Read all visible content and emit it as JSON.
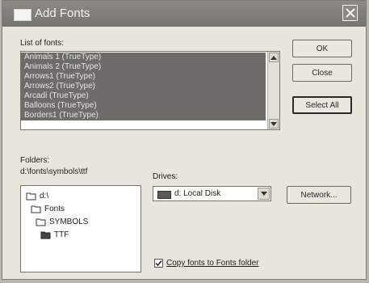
{
  "window": {
    "title": "Add Fonts"
  },
  "fonts_list": {
    "label": "List of fonts:",
    "items": [
      "Animals 1 (TrueType)",
      "Animals 2 (TrueType)",
      "Arrows1 (TrueType)",
      "Arrows2 (TrueType)",
      "Arcadi (TrueType)",
      "Balloons (TrueType)",
      "Borders1 (TrueType)"
    ]
  },
  "buttons": {
    "ok": "OK",
    "close": "Close",
    "select_all": "Select All",
    "network": "Network..."
  },
  "folders": {
    "label": "Folders:",
    "path": "d:\\fonts\\symbols\\ttf",
    "tree": [
      "d:\\",
      "Fonts",
      "SYMBOLS",
      "TTF"
    ]
  },
  "drives": {
    "label": "Drives:",
    "value": "d: Local Disk"
  },
  "copy_fonts": {
    "label": "Copy fonts to Fonts folder",
    "checked": true
  }
}
